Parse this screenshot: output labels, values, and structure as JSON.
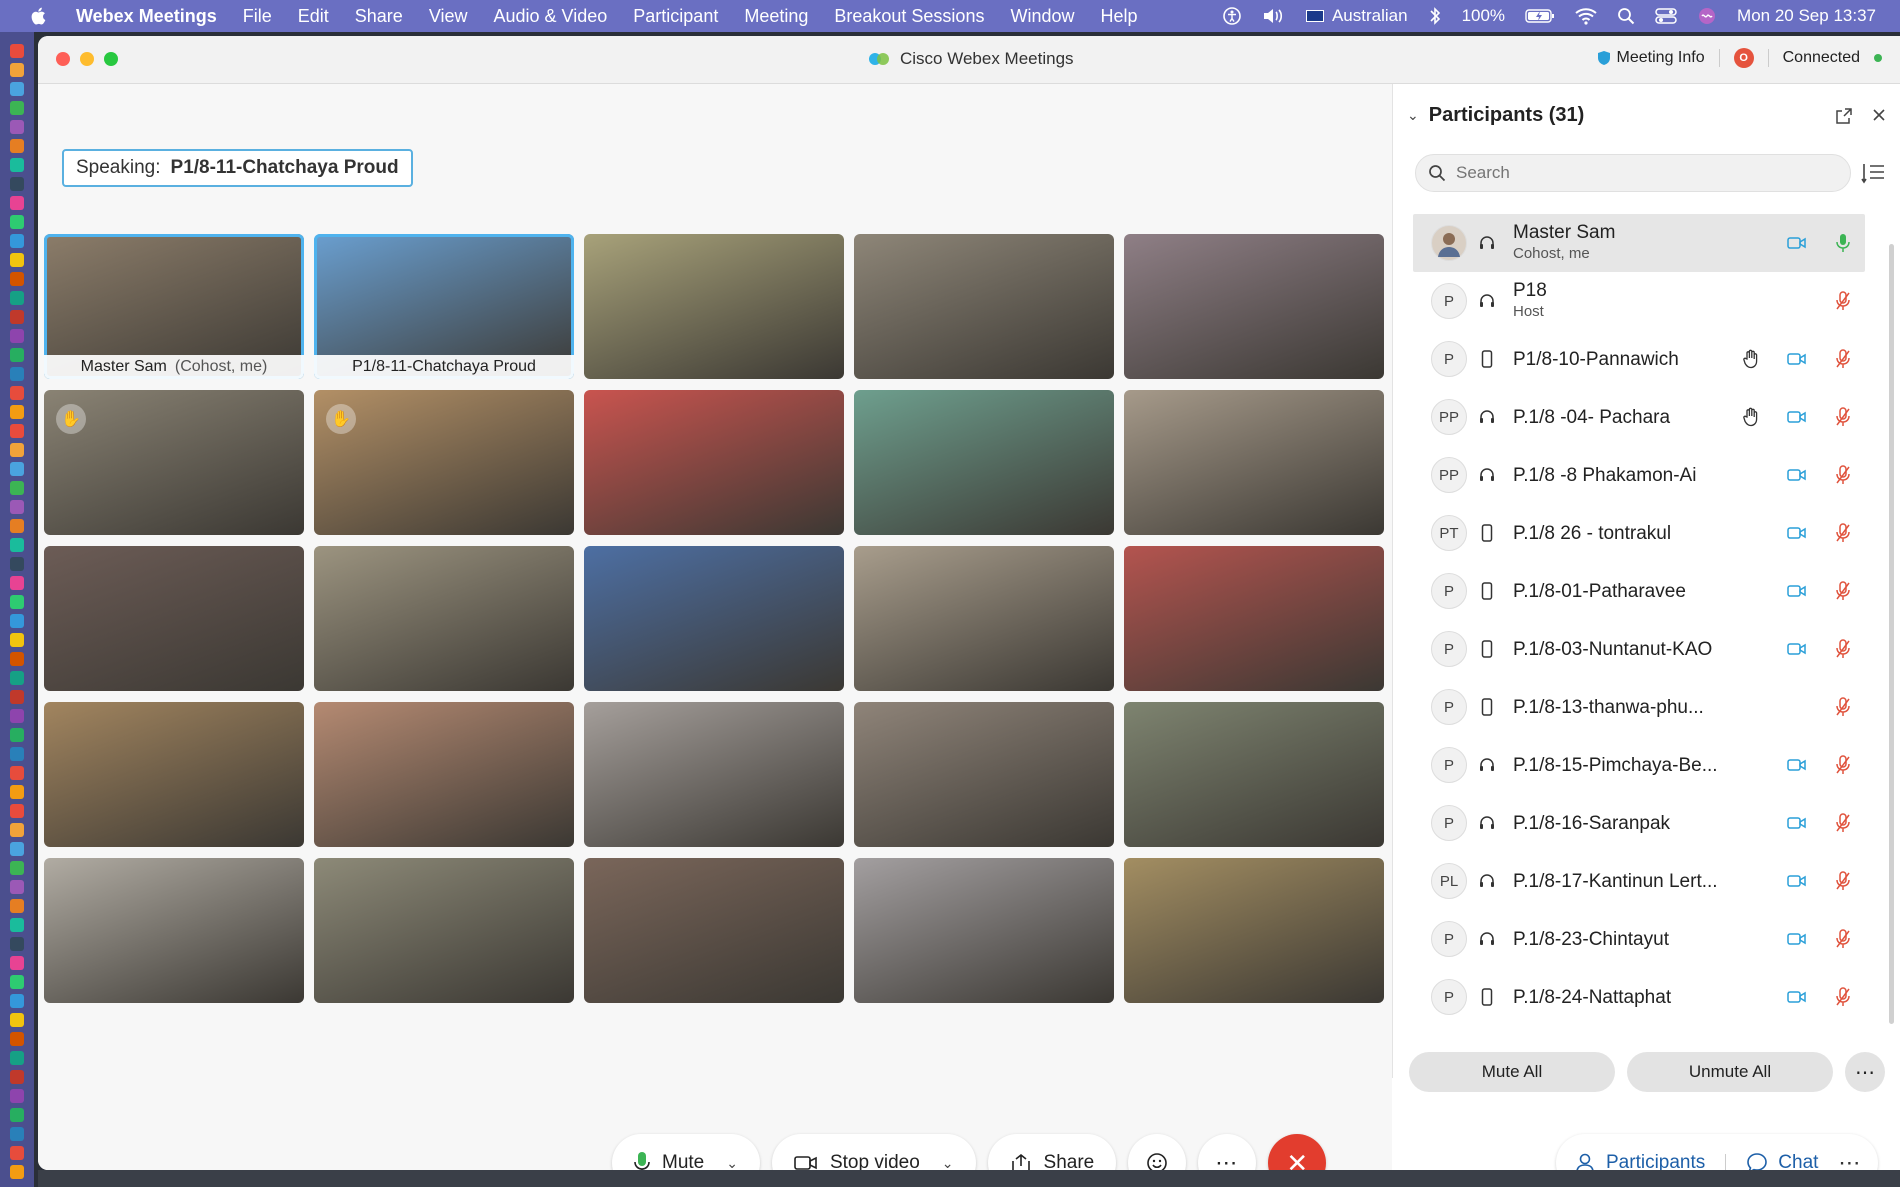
{
  "menubar": {
    "app_name": "Webex Meetings",
    "items": [
      "File",
      "Edit",
      "Share",
      "View",
      "Audio & Video",
      "Participant",
      "Meeting",
      "Breakout Sessions",
      "Window",
      "Help"
    ],
    "input_source": "Australian",
    "battery": "100%",
    "clock": "Mon 20 Sep  13:37"
  },
  "window": {
    "title": "Cisco Webex Meetings",
    "meeting_info": "Meeting Info",
    "rec_badge": "O",
    "status": "Connected"
  },
  "stage": {
    "speaking_label": "Speaking:",
    "speaking_name": "P1/8-11-Chatchaya Proud",
    "tiles": [
      {
        "label": "Master Sam",
        "role": "(Cohost, me)",
        "active": true,
        "bg": "#8c7d6a"
      },
      {
        "label": "P1/8-11-Chatchaya Proud",
        "role": "",
        "active": true,
        "bg": "#6a9fd0"
      },
      {
        "label": "",
        "role": "",
        "bg": "#a8a27a"
      },
      {
        "label": "",
        "role": "",
        "bg": "#8e8678"
      },
      {
        "label": "",
        "role": "",
        "bg": "#8f7f86"
      },
      {
        "label": "",
        "role": "",
        "bg": "#8a8374",
        "hand": true
      },
      {
        "label": "",
        "role": "",
        "bg": "#b39066",
        "hand": true
      },
      {
        "label": "",
        "role": "",
        "bg": "#c9544f"
      },
      {
        "label": "",
        "role": "",
        "bg": "#6e9f8e"
      },
      {
        "label": "",
        "role": "",
        "bg": "#a69a8a"
      },
      {
        "label": "",
        "role": "",
        "bg": "#6c5c56"
      },
      {
        "label": "",
        "role": "",
        "bg": "#9c9480"
      },
      {
        "label": "",
        "role": "",
        "bg": "#4d6fa3"
      },
      {
        "label": "",
        "role": "",
        "bg": "#a89d8c"
      },
      {
        "label": "",
        "role": "",
        "bg": "#b4544f"
      },
      {
        "label": "",
        "role": "",
        "bg": "#a2855f"
      },
      {
        "label": "",
        "role": "",
        "bg": "#b58a72"
      },
      {
        "label": "",
        "role": "",
        "bg": "#a59f9b"
      },
      {
        "label": "",
        "role": "",
        "bg": "#8f8479"
      },
      {
        "label": "",
        "role": "",
        "bg": "#7e8470"
      },
      {
        "label": "",
        "role": "",
        "bg": "#b1aca3"
      },
      {
        "label": "",
        "role": "",
        "bg": "#8d8a78"
      },
      {
        "label": "",
        "role": "",
        "bg": "#7a665a"
      },
      {
        "label": "",
        "role": "",
        "bg": "#a39fa0"
      },
      {
        "label": "",
        "role": "",
        "bg": "#a38e62"
      }
    ]
  },
  "controls": {
    "mute": "Mute",
    "stop_video": "Stop video",
    "share": "Share",
    "participants": "Participants",
    "chat": "Chat"
  },
  "panel": {
    "title": "Participants (31)",
    "search_placeholder": "Search",
    "mute_all": "Mute All",
    "unmute_all": "Unmute All",
    "participants": [
      {
        "initials": "",
        "name": "Master Sam",
        "sub": "Cohost, me",
        "device": "headset",
        "hand": false,
        "video": true,
        "mic": "on",
        "me": true
      },
      {
        "initials": "P",
        "name": "P18",
        "sub": "Host",
        "device": "headset",
        "hand": false,
        "video": false,
        "mic": "muted"
      },
      {
        "initials": "P",
        "name": "P1/8-10-Pannawich",
        "sub": "",
        "device": "phone",
        "hand": true,
        "video": true,
        "mic": "muted"
      },
      {
        "initials": "PP",
        "name": "P.1/8 -04- Pachara",
        "sub": "",
        "device": "headset",
        "hand": true,
        "video": true,
        "mic": "muted"
      },
      {
        "initials": "PP",
        "name": "P.1/8 -8 Phakamon-Ai",
        "sub": "",
        "device": "headset",
        "hand": false,
        "video": true,
        "mic": "muted"
      },
      {
        "initials": "PT",
        "name": "P.1/8 26 - tontrakul",
        "sub": "",
        "device": "phone",
        "hand": false,
        "video": true,
        "mic": "muted"
      },
      {
        "initials": "P",
        "name": "P.1/8-01-Patharavee",
        "sub": "",
        "device": "phone",
        "hand": false,
        "video": true,
        "mic": "muted"
      },
      {
        "initials": "P",
        "name": "P.1/8-03-Nuntanut-KAO",
        "sub": "",
        "device": "phone",
        "hand": false,
        "video": true,
        "mic": "muted"
      },
      {
        "initials": "P",
        "name": "P.1/8-13-thanwa-phu...",
        "sub": "",
        "device": "phone",
        "hand": false,
        "video": false,
        "mic": "muted"
      },
      {
        "initials": "P",
        "name": "P.1/8-15-Pimchaya-Be...",
        "sub": "",
        "device": "headset",
        "hand": false,
        "video": true,
        "mic": "muted"
      },
      {
        "initials": "P",
        "name": "P.1/8-16-Saranpak",
        "sub": "",
        "device": "headset",
        "hand": false,
        "video": true,
        "mic": "muted"
      },
      {
        "initials": "PL",
        "name": "P.1/8-17-Kantinun Lert...",
        "sub": "",
        "device": "headset",
        "hand": false,
        "video": true,
        "mic": "muted"
      },
      {
        "initials": "P",
        "name": "P.1/8-23-Chintayut",
        "sub": "",
        "device": "headset",
        "hand": false,
        "video": true,
        "mic": "muted"
      },
      {
        "initials": "P",
        "name": "P.1/8-24-Nattaphat",
        "sub": "",
        "device": "phone",
        "hand": false,
        "video": true,
        "mic": "muted"
      }
    ]
  },
  "colors": {
    "accent": "#1d5fa8",
    "video_icon": "#2a9fd8",
    "mic_muted": "#e0533d",
    "mic_on": "#3cb454",
    "leave": "#e23d2e"
  }
}
